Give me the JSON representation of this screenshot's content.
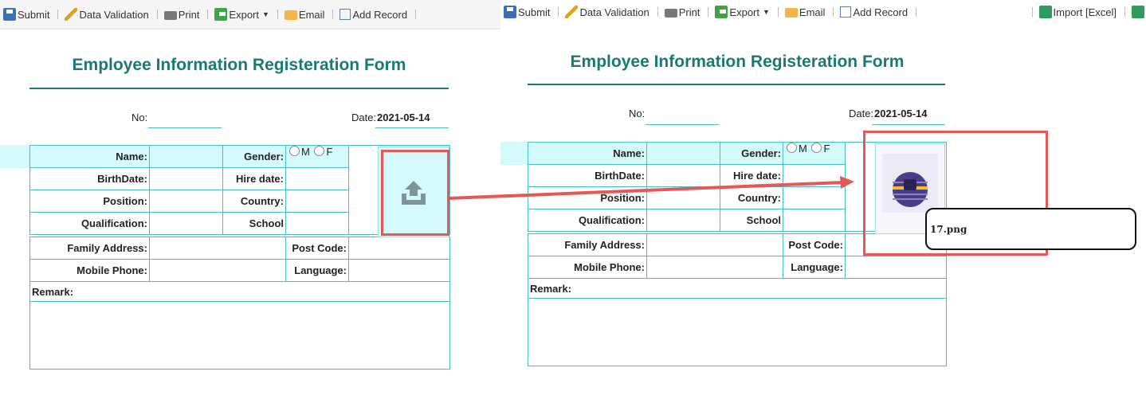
{
  "toolbar": {
    "submit": "Submit",
    "data_validation": "Data Validation",
    "print": "Print",
    "export": "Export",
    "email": "Email",
    "add_record": "Add Record",
    "import": "Import [Excel]"
  },
  "form": {
    "title": "Employee Information Registeration Form",
    "no_label": "No:",
    "date_label": "Date:",
    "date_value": "2021-05-14",
    "labels": {
      "name": "Name:",
      "gender": "Gender:",
      "gender_m": "M",
      "gender_f": "F",
      "birthdate": "BirthDate:",
      "hire_date": "Hire date:",
      "position": "Position:",
      "country": "Country:",
      "qualification": "Qualification:",
      "school": "School",
      "family_address": "Family Address:",
      "post_code": "Post Code:",
      "mobile_phone": "Mobile Phone:",
      "language": "Language:",
      "remark": "Remark:"
    }
  },
  "upload": {
    "icon": "upload-tray-arrow-icon",
    "filename": "17.png"
  },
  "colors": {
    "title": "#1a7a72",
    "cell_border": "#4bbcc4",
    "highlight_row": "#d4fafa",
    "annotation": "#e45858"
  }
}
